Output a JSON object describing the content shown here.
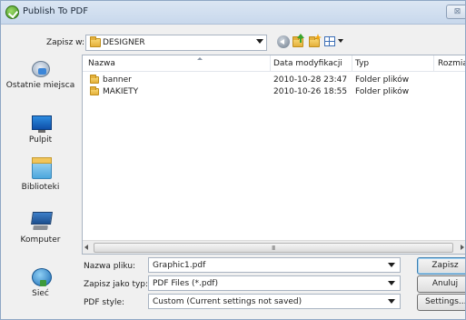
{
  "window": {
    "title": "Publish To PDF",
    "close_glyph": "⊠"
  },
  "location": {
    "label": "Zapisz w:",
    "value": "DESIGNER"
  },
  "places": [
    {
      "label": "Ostatnie miejsca",
      "icon": "recent-places-icon"
    },
    {
      "label": "Pulpit",
      "icon": "desktop-icon"
    },
    {
      "label": "Biblioteki",
      "icon": "libraries-icon"
    },
    {
      "label": "Komputer",
      "icon": "computer-icon"
    },
    {
      "label": "Sieć",
      "icon": "network-icon"
    }
  ],
  "file_list": {
    "columns": [
      "Nazwa",
      "Data modyfikacji",
      "Typ",
      "Rozmiar"
    ],
    "rows": [
      {
        "name": "banner",
        "modified": "2010-10-28 23:47",
        "type": "Folder plików",
        "size": ""
      },
      {
        "name": "MAKIETY",
        "modified": "2010-10-26 18:55",
        "type": "Folder plików",
        "size": ""
      }
    ],
    "scroll_grip": "III"
  },
  "form": {
    "filename_label": "Nazwa pliku:",
    "filename_value": "Graphic1.pdf",
    "filetype_label": "Zapisz jako typ:",
    "filetype_value": "PDF Files (*.pdf)",
    "style_label": "PDF style:",
    "style_value": "Custom (Current settings not saved)"
  },
  "buttons": {
    "save": "Zapisz",
    "cancel": "Anuluj",
    "settings": "Settings..."
  },
  "colors": {
    "title_bar": "#c8d8ec",
    "window_bg": "#f0f0f0",
    "folder": "#e4b03a"
  }
}
